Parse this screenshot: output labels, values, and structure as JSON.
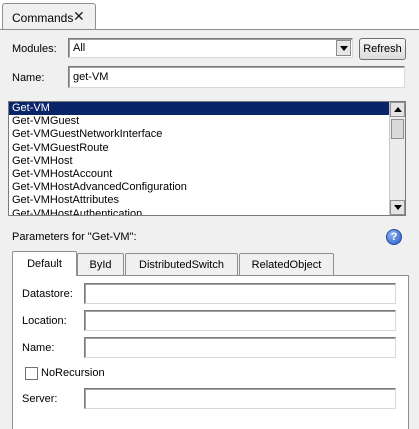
{
  "window_tab": {
    "title": "Commands",
    "close_glyph": "✕"
  },
  "modules": {
    "label": "Modules:",
    "value": "All",
    "refresh_label": "Refresh"
  },
  "name_filter": {
    "label": "Name:",
    "value": "get-VM"
  },
  "commands": [
    "Get-VM",
    "Get-VMGuest",
    "Get-VMGuestNetworkInterface",
    "Get-VMGuestRoute",
    "Get-VMHost",
    "Get-VMHostAccount",
    "Get-VMHostAdvancedConfiguration",
    "Get-VMHostAttributes",
    "Get-VMHostAuthentication"
  ],
  "selected_command": "Get-VM",
  "params_header": "Parameters for \"Get-VM\":",
  "help_glyph": "?",
  "param_tabs": [
    "Default",
    "ById",
    "DistributedSwitch",
    "RelatedObject"
  ],
  "active_param_tab": "Default",
  "fields": {
    "datastore_label": "Datastore:",
    "location_label": "Location:",
    "name_label": "Name:",
    "norecursion_label": "NoRecursion",
    "server_label": "Server:"
  },
  "colors": {
    "selection": "#0a246a",
    "panel": "#f0f0f0",
    "help_icon": "#2a5cc4"
  },
  "icons": [
    "close-icon",
    "dropdown-arrow-icon",
    "scroll-up-arrow-icon",
    "scroll-down-arrow-icon",
    "help-icon"
  ]
}
